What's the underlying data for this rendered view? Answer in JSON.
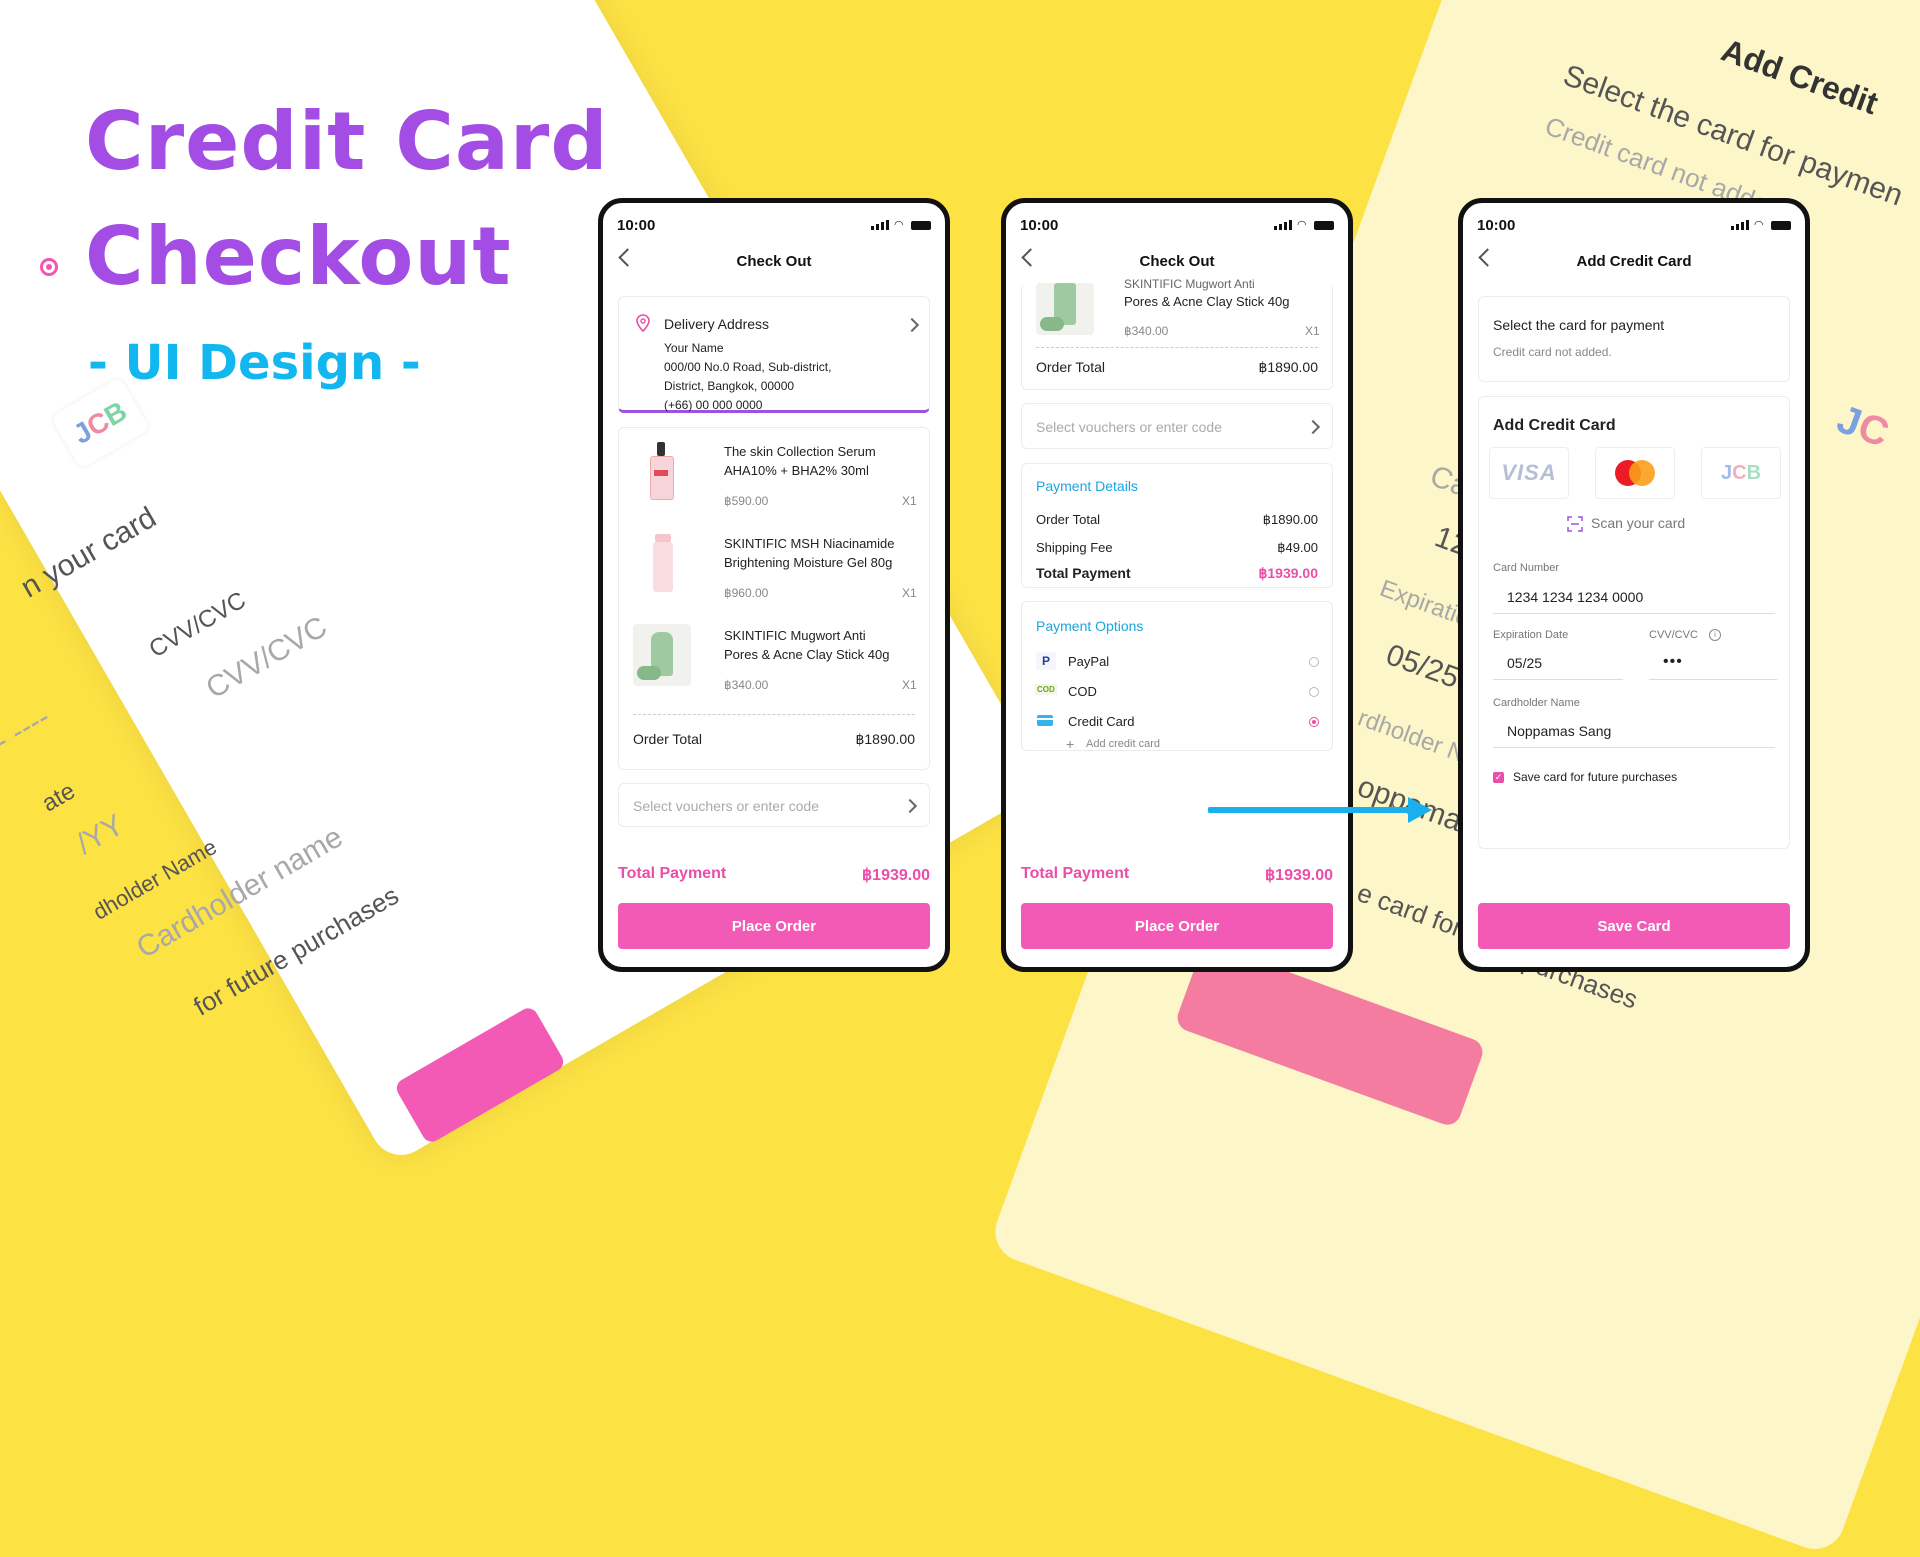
{
  "headline": {
    "line1": "Credit Card",
    "line2": "Checkout",
    "sub": "- UI Design -"
  },
  "colors": {
    "background": "#fde244",
    "accent_pink": "#f35ab6",
    "accent_purple": "#a34de5",
    "accent_blue": "#12b7ef"
  },
  "deco_left": {
    "scan": "n your card",
    "cvv_label": "CVV/CVC",
    "cvv_placeholder": "CVV/CVC",
    "date_label": "ate",
    "date_placeholder": "/YY",
    "name_label": "dholder Name",
    "name_placeholder": "Cardholder name",
    "save": "for future purchases",
    "dashes": "-- ----"
  },
  "deco_right": {
    "title": "Add Credit",
    "select": "Select the card for paymen",
    "not_added": "Credit card not added.",
    "ca": "Ca",
    "num": "12",
    "expiration": "Expiratio",
    "date": "05/25",
    "holder": "rdholder Na",
    "name": "oppamas",
    "card_for": "e card for",
    "purchases": "purchases"
  },
  "screen1": {
    "time": "10:00",
    "title": "Check Out",
    "address": {
      "heading": "Delivery Address",
      "name": "Your Name",
      "line1": "000/00  No.0 Road, Sub-district,",
      "line2": "District, Bangkok, 00000",
      "phone": "(+66) 00 000 0000"
    },
    "items": [
      {
        "name1": "The skin Collection Serum",
        "name2": "AHA10% + BHA2% 30ml",
        "price": "฿590.00",
        "qty": "X1"
      },
      {
        "name1": "SKINTIFIC MSH Niacinamide",
        "name2": "Brightening Moisture Gel 80g",
        "price": "฿960.00",
        "qty": "X1"
      },
      {
        "name1": "SKINTIFIC Mugwort Anti",
        "name2": "Pores & Acne Clay Stick 40g",
        "price": "฿340.00",
        "qty": "X1"
      }
    ],
    "order_total_label": "Order Total",
    "order_total": "฿1890.00",
    "voucher_placeholder": "Select vouchers or enter code",
    "total_label": "Total Payment",
    "total": "฿1939.00",
    "button": "Place Order"
  },
  "screen2": {
    "time": "10:00",
    "title": "Check Out",
    "item_cut": "SKINTIFIC Mugwort Anti",
    "item_name2": "Pores & Acne Clay Stick 40g",
    "item_price": "฿340.00",
    "item_qty": "X1",
    "order_total_label": "Order Total",
    "order_total": "฿1890.00",
    "voucher_placeholder": "Select vouchers or enter code",
    "details": {
      "heading": "Payment Details",
      "order_total_label": "Order Total",
      "order_total": "฿1890.00",
      "shipping_label": "Shipping Fee",
      "shipping": "฿49.00",
      "total_label": "Total Payment",
      "total": "฿1939.00"
    },
    "options": {
      "heading": "Payment Options",
      "paypal": "PayPal",
      "cod": "COD",
      "cod_badge": "COD",
      "credit": "Credit Card",
      "add": "Add credit card",
      "selected": "Credit Card"
    },
    "total_label": "Total Payment",
    "total": "฿1939.00",
    "button": "Place Order"
  },
  "screen3": {
    "time": "10:00",
    "title": "Add Credit Card",
    "select": "Select the card for payment",
    "not_added": "Credit card not added.",
    "add_heading": "Add Credit Card",
    "visa": "VISA",
    "jcb": "JCB",
    "scan": "Scan your card",
    "card_number_label": "Card Number",
    "card_number": "1234 1234 1234 0000",
    "exp_label": "Expiration Date",
    "exp": "05/25",
    "cvv_label": "CVV/CVC",
    "cvv": "•••",
    "holder_label": "Cardholder Name",
    "holder": "Noppamas Sang",
    "save_label": "Save card for future purchases",
    "save_checked": true,
    "button": "Save Card"
  }
}
